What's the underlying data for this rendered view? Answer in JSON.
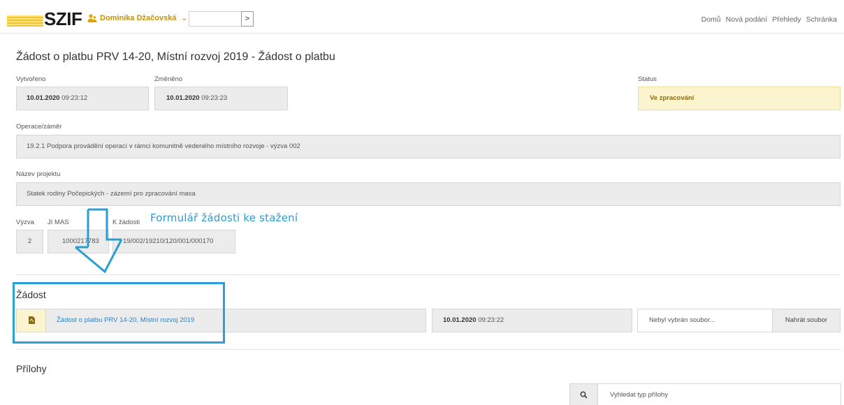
{
  "header": {
    "logo_text": "SZIF",
    "user_name": "Dominika Džačovská",
    "user_chevron": "⌄",
    "go_button": ">",
    "nav": [
      "Domů",
      "Nová podání",
      "Přehledy",
      "Schránka"
    ]
  },
  "form": {
    "title": "Žádost o platbu PRV 14-20, Místní rozvoj 2019 - Žádost o platbu",
    "created_label": "Vytvořeno",
    "created_date": "10.01.2020",
    "created_time": "09:23:12",
    "changed_label": "Změněno",
    "changed_date": "10.01.2020",
    "changed_time": "09:23:23",
    "status_label": "Status",
    "status_value": "Ve zpracování",
    "operation_label": "Operace/záměr",
    "operation_value": "19.2.1 Podpora provádění operací v rámci komunitně vedeného místního rozvoje - výzva 002",
    "project_label": "Název projektu",
    "project_value": "Statek rodiny Počepických - zázemí pro zpracování masa",
    "vyzva_label": "Výzva",
    "vyzva_value": "2",
    "jimas_label": "JI MAS",
    "jimas_value": "1000217783",
    "kzadosti_label": "K žádosti",
    "kzadosti_value": "19/002/19210/120/001/000170"
  },
  "annotation": {
    "text": "Formulář žádosti ke stažení",
    "color": "#2a9ed3"
  },
  "zadost": {
    "section_title": "Žádost",
    "doc_link": "Žádost o platbu PRV 14-20, Místní rozvoj 2019",
    "doc_date": "10.01.2020",
    "doc_time": "09:23:22",
    "file_placeholder": "Nebyl vybrán soubor...",
    "upload_label": "Nahrát soubor"
  },
  "prilohy": {
    "section_title": "Přílohy",
    "search_placeholder": "Vyhledat typ přílohy"
  },
  "colors": {
    "accent": "#c69200",
    "status_bg": "#fcf3cf",
    "link": "#2f7fc1"
  }
}
